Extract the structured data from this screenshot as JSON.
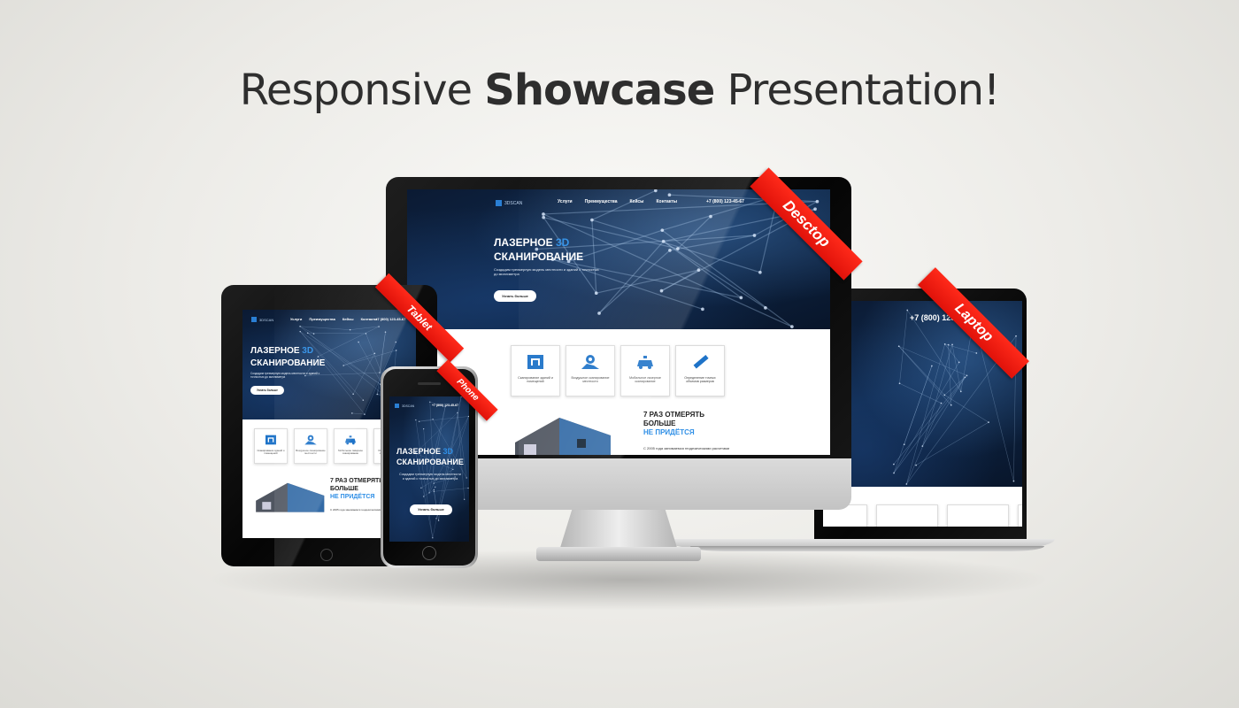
{
  "headline": {
    "pre": "Responsive ",
    "bold": "Showcase",
    "post": " Presentation!"
  },
  "ribbons": {
    "desktop": "Desctop",
    "tablet": "Tablet",
    "phone": "Phone",
    "laptop": "Laptop"
  },
  "site": {
    "logo": "3DSCAN",
    "nav": [
      "Услуги",
      "Преимущества",
      "Кейсы",
      "Контакты"
    ],
    "phone": "+7 (800) 123-45-67",
    "hero_title_1": "ЛАЗЕРНОЕ ",
    "hero_title_accent": "3D",
    "hero_title_2": "СКАНИРОВАНИЕ",
    "hero_sub": "Создадим трехмерную модель местности и зданий с точностью до миллиметра",
    "hero_button": "Узнать больше",
    "cards": [
      {
        "icon": "building-scan-icon",
        "label": "Сканирование зданий и помещений"
      },
      {
        "icon": "map-pin-icon",
        "label": "Воздушное сканирование местности"
      },
      {
        "icon": "car-icon",
        "label": "Мобильное лазерное сканирование"
      },
      {
        "icon": "ruler-icon",
        "label": "Определение точных объемов размеров"
      }
    ],
    "promo_title_1": "7 РАЗ ОТМЕРЯТЬ",
    "promo_title_2": "БОЛЬШЕ",
    "promo_title_accent": "НЕ ПРИДЁТСЯ",
    "promo_text": "С 2005 года занимаемся геодезическими расчетами"
  },
  "colors": {
    "accent": "#2f8fe6",
    "ribbon": "#e8170e",
    "hero_dark": "#0b1a33"
  }
}
